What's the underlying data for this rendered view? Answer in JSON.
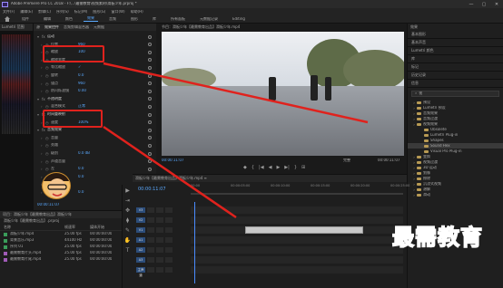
{
  "titlebar": {
    "title": "Adobe Premiere Pro CC 2018 - F:\\...\\最需教育\\视频素材\\滑板少年.prproj *",
    "minimize": "—",
    "maximize": "▢",
    "close": "✕"
  },
  "menu": [
    "文件(F)",
    "编辑(E)",
    "剪辑(C)",
    "序列(S)",
    "标记(M)",
    "图形(G)",
    "窗口(W)",
    "帮助(H)"
  ],
  "workspaces": [
    "组件",
    "编辑",
    "颜色",
    "效果",
    "音频",
    "图形",
    "库",
    "所有面板",
    "元数据记录",
    "Editing"
  ],
  "active_workspace_index": 3,
  "effect_controls": {
    "tabs": [
      "源",
      "效果控件",
      "音频剪辑混合器",
      "元数据"
    ],
    "props": [
      {
        "name": "运动",
        "value": "",
        "header": true
      },
      {
        "name": "位置",
        "value": "960"
      },
      {
        "name": "缩放",
        "value": "100"
      },
      {
        "name": "缩放宽度",
        "value": ""
      },
      {
        "name": "等比缩放",
        "value": "✓"
      },
      {
        "name": "旋转",
        "value": "0.0"
      },
      {
        "name": "锚点",
        "value": "960"
      },
      {
        "name": "防闪烁滤镜",
        "value": "0.00"
      },
      {
        "name": "不透明度",
        "value": "",
        "header": true
      },
      {
        "name": "混合模式",
        "value": "正常"
      },
      {
        "name": "时间重映射",
        "value": "",
        "header": true
      },
      {
        "name": "速度",
        "value": "100%"
      },
      {
        "name": "音频效果",
        "value": "",
        "header": true
      },
      {
        "name": "音量",
        "value": ""
      },
      {
        "name": "旁路",
        "value": ""
      },
      {
        "name": "级别",
        "value": "0.0 dB"
      },
      {
        "name": "声道音量",
        "value": ""
      },
      {
        "name": "左",
        "value": "0.0"
      },
      {
        "name": "右",
        "value": "0.0"
      },
      {
        "name": "声像器",
        "value": ""
      },
      {
        "name": "平衡",
        "value": "0.0"
      }
    ],
    "timecode": "00:00:11:07"
  },
  "program": {
    "title": "节目：滑板少年【最需教育出品】滑板少年.mp4",
    "timecode": "00:00:11:07",
    "fit": "完整",
    "duration": "00:00:11:07",
    "buttons": [
      "◆",
      "{",
      "|◀",
      "◀",
      "▶",
      "▶|",
      "}",
      "⊞"
    ]
  },
  "rightpanel": {
    "title": "效果",
    "sections": [
      "基本图形",
      "基本声音",
      "Lumetri 颜色",
      "库",
      "标记",
      "历史记录",
      "信息"
    ],
    "search": "视",
    "tree": [
      {
        "label": "预设",
        "depth": 0
      },
      {
        "label": "Lumetri 预设",
        "depth": 0
      },
      {
        "label": "音频效果",
        "depth": 0
      },
      {
        "label": "音频过渡",
        "depth": 0
      },
      {
        "label": "视频效果",
        "depth": 0
      },
      {
        "label": "Obsolete",
        "depth": 1
      },
      {
        "label": "Lumetri Plug-in",
        "depth": 1
      },
      {
        "label": "Shapes",
        "depth": 1
      },
      {
        "label": "Sound Hex",
        "depth": 1,
        "selected": true
      },
      {
        "label": "Visual Pro Plug-in",
        "depth": 1
      },
      {
        "label": "变换",
        "depth": 0
      },
      {
        "label": "视频过渡",
        "depth": 0
      },
      {
        "label": "3D 运动",
        "depth": 0
      },
      {
        "label": "划像",
        "depth": 0
      },
      {
        "label": "擦除",
        "depth": 0
      },
      {
        "label": "沉浸式视频",
        "depth": 0
      },
      {
        "label": "溶解",
        "depth": 0
      },
      {
        "label": "滑动",
        "depth": 0
      }
    ]
  },
  "project": {
    "tabs": "项目：滑板少年【最需教育出品】滑板少年",
    "path": "滑板少年【最需教育出品】.prproj",
    "columns": [
      "名称",
      "帧速率",
      "媒体开始"
    ],
    "rows": [
      {
        "name": "滑板少年.mp4",
        "rate": "25.00 fps",
        "start": "00:00:00:00",
        "color": "#3a9c5a"
      },
      {
        "name": "背景音乐.mp3",
        "rate": "44100 Hz",
        "start": "00:00:00:00",
        "color": "#3a9c5a"
      },
      {
        "name": "序列 01",
        "rate": "25.00 fps",
        "start": "00:00:00:00",
        "color": "#3a9c5a"
      },
      {
        "name": "最需教育片头.mp4",
        "rate": "25.00 fps",
        "start": "00:00:00:00",
        "color": "#a05bb7"
      },
      {
        "name": "最需教育片尾.mp4",
        "rate": "25.00 fps",
        "start": "00:00:00:00",
        "color": "#a05bb7"
      }
    ]
  },
  "timeline": {
    "tabs": "滑板少年【最需教育出品】滑板少年.mp4 ≡",
    "timecode": "00:00:11:07",
    "ticks": [
      "00:00",
      "00:00:05:00",
      "00:00:10:00",
      "00:00:15:00",
      "00:00:20:00",
      "00:00:25:00"
    ],
    "tracks": [
      {
        "name": "V3"
      },
      {
        "name": "V2"
      },
      {
        "name": "V1",
        "clip": "滑板少年.mp4 [V]"
      },
      {
        "name": "A1"
      },
      {
        "name": "A2"
      },
      {
        "name": "A3"
      },
      {
        "name": "主声道"
      }
    ]
  },
  "tools": [
    "▶",
    "⇥",
    "✥",
    "⧫",
    "✎",
    "✋",
    "T"
  ],
  "watermark": "最需教育",
  "scopes": {
    "label": "Lumetri 范围"
  },
  "colors": {
    "accent": "#5aa9ff",
    "annotation": "#e0221d",
    "watermark": "#1a5bd8"
  }
}
